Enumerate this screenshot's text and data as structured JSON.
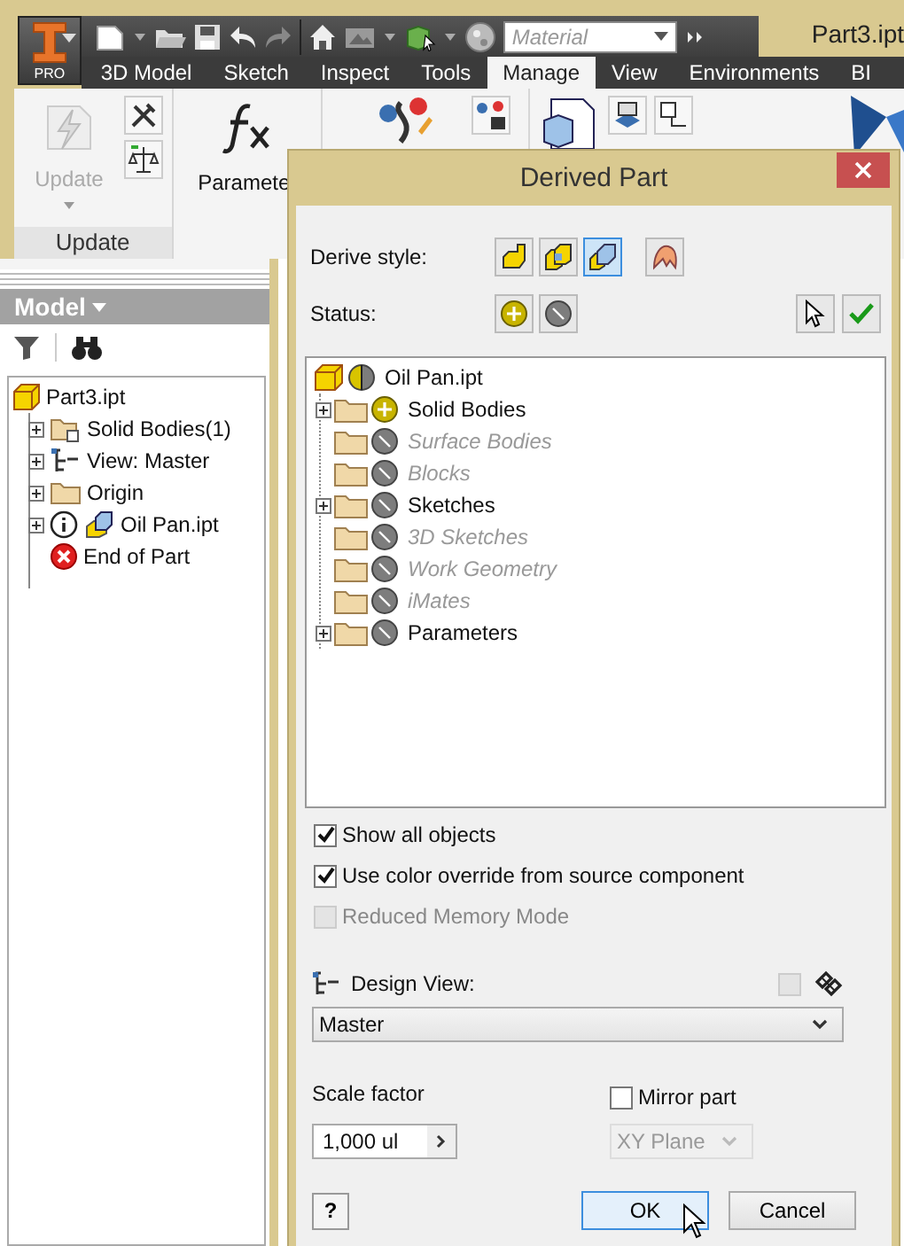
{
  "window": {
    "title": "Part3.ipt"
  },
  "app_button": {
    "badge": "PRO"
  },
  "material_field": {
    "placeholder": "Material"
  },
  "tabs": [
    {
      "label": "3D Model",
      "selected": false
    },
    {
      "label": "Sketch",
      "selected": false
    },
    {
      "label": "Inspect",
      "selected": false
    },
    {
      "label": "Tools",
      "selected": false
    },
    {
      "label": "Manage",
      "selected": true
    },
    {
      "label": "View",
      "selected": false
    },
    {
      "label": "Environments",
      "selected": false
    },
    {
      "label": "BI",
      "selected": false
    }
  ],
  "ribbon": {
    "update_button": {
      "label": "Update",
      "disabled": true
    },
    "parameters_button": {
      "label": "Paramete"
    },
    "update_panel_label": "Update"
  },
  "browser": {
    "title": "Model",
    "tree": [
      {
        "label": "Part3.ipt",
        "kind": "part",
        "children": [
          {
            "label": "Solid Bodies(1)",
            "kind": "bodies",
            "collapsed": true
          },
          {
            "label": "View: Master",
            "kind": "view",
            "collapsed": true
          },
          {
            "label": "Origin",
            "kind": "folder",
            "collapsed": true
          },
          {
            "label": "Oil Pan.ipt",
            "kind": "derived",
            "collapsed": true
          },
          {
            "label": "End of Part",
            "kind": "end",
            "collapsed": false
          }
        ]
      }
    ]
  },
  "dialog": {
    "title": "Derived Part",
    "derive_style": {
      "label": "Derive style:",
      "options": [
        {
          "kind": "single",
          "selected": false
        },
        {
          "kind": "multi",
          "selected": false
        },
        {
          "kind": "bodies",
          "selected": true
        },
        {
          "kind": "surface",
          "selected": false
        }
      ]
    },
    "status": {
      "label": "Status:",
      "options": [
        {
          "kind": "include"
        },
        {
          "kind": "exclude"
        }
      ]
    },
    "tree": [
      {
        "label": "Oil Pan.ipt",
        "kind": "partial",
        "children": [
          {
            "label": "Solid Bodies",
            "kind": "include",
            "collapsed": true,
            "disabled": false
          },
          {
            "label": "Surface Bodies",
            "kind": "exclude",
            "collapsed": false,
            "disabled": true
          },
          {
            "label": "Blocks",
            "kind": "exclude",
            "collapsed": false,
            "disabled": true
          },
          {
            "label": "Sketches",
            "kind": "exclude",
            "collapsed": true,
            "disabled": false
          },
          {
            "label": "3D Sketches",
            "kind": "exclude",
            "collapsed": false,
            "disabled": true
          },
          {
            "label": "Work Geometry",
            "kind": "exclude",
            "collapsed": false,
            "disabled": true
          },
          {
            "label": "iMates",
            "kind": "exclude",
            "collapsed": false,
            "disabled": true
          },
          {
            "label": "Parameters",
            "kind": "exclude",
            "collapsed": true,
            "disabled": false
          }
        ]
      }
    ],
    "options": [
      {
        "label": "Show all objects",
        "checked": true,
        "disabled": false
      },
      {
        "label": "Use color override from source component",
        "checked": true,
        "disabled": false
      },
      {
        "label": "Reduced Memory Mode",
        "checked": false,
        "disabled": true
      }
    ],
    "design_view": {
      "label": "Design View:",
      "value": "Master",
      "associative": false
    },
    "scale_factor": {
      "label": "Scale factor",
      "value": "1,000 ul"
    },
    "mirror": {
      "label": "Mirror part",
      "checked": false,
      "plane": "XY Plane",
      "plane_disabled": true
    },
    "help_button": "?",
    "buttons": [
      {
        "label": "OK",
        "kind": "default"
      },
      {
        "label": "Cancel",
        "kind": "normal"
      }
    ]
  }
}
